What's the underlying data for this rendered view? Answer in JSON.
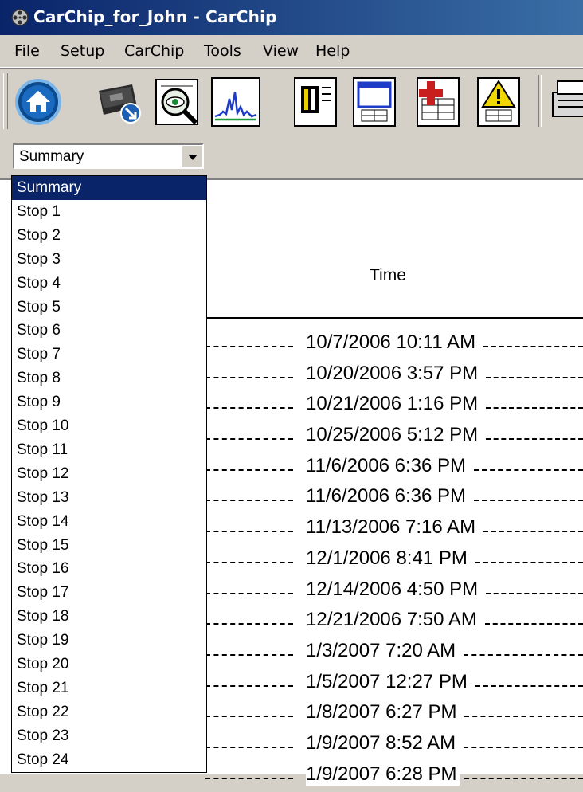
{
  "window": {
    "title": "CarChip_for_John - CarChip"
  },
  "menu": [
    "File",
    "Setup",
    "CarChip",
    "Tools",
    "View",
    "Help"
  ],
  "toolbar": {
    "buttons": [
      {
        "name": "home-icon"
      },
      {
        "name": "download-icon"
      },
      {
        "name": "view-magnify-icon"
      },
      {
        "name": "graph-icon"
      },
      {
        "name": "report-icon"
      },
      {
        "name": "window-report-icon"
      },
      {
        "name": "medical-report-icon"
      },
      {
        "name": "alert-report-icon"
      },
      {
        "name": "printer-icon"
      }
    ]
  },
  "combo": {
    "value": "Summary"
  },
  "dropdown": {
    "selected": "Summary",
    "options": [
      "Summary",
      "Stop 1",
      "Stop 2",
      "Stop 3",
      "Stop 4",
      "Stop 5",
      "Stop 6",
      "Stop 7",
      "Stop 8",
      "Stop 9",
      "Stop 10",
      "Stop 11",
      "Stop 12",
      "Stop 13",
      "Stop 14",
      "Stop 15",
      "Stop 16",
      "Stop 17",
      "Stop 18",
      "Stop 19",
      "Stop 20",
      "Stop 21",
      "Stop 22",
      "Stop 23",
      "Stop 24"
    ]
  },
  "report": {
    "column_header": "Time",
    "times": [
      "10/7/2006 10:11 AM",
      "10/20/2006 3:57 PM",
      "10/21/2006 1:16 PM",
      "10/25/2006 5:12 PM",
      "11/6/2006 6:36 PM",
      "11/6/2006 6:36 PM",
      "11/13/2006 7:16 AM",
      "12/1/2006 8:41 PM",
      "12/14/2006 4:50 PM",
      "12/21/2006 7:50 AM",
      "1/3/2007 7:20 AM",
      "1/5/2007 12:27 PM",
      "1/8/2007 6:27 PM",
      "1/9/2007 8:52 AM",
      "1/9/2007 6:28 PM"
    ]
  },
  "colors": {
    "titlebar": "#0a246a",
    "selection": "#0a246a",
    "chrome": "#d4d0c8"
  }
}
